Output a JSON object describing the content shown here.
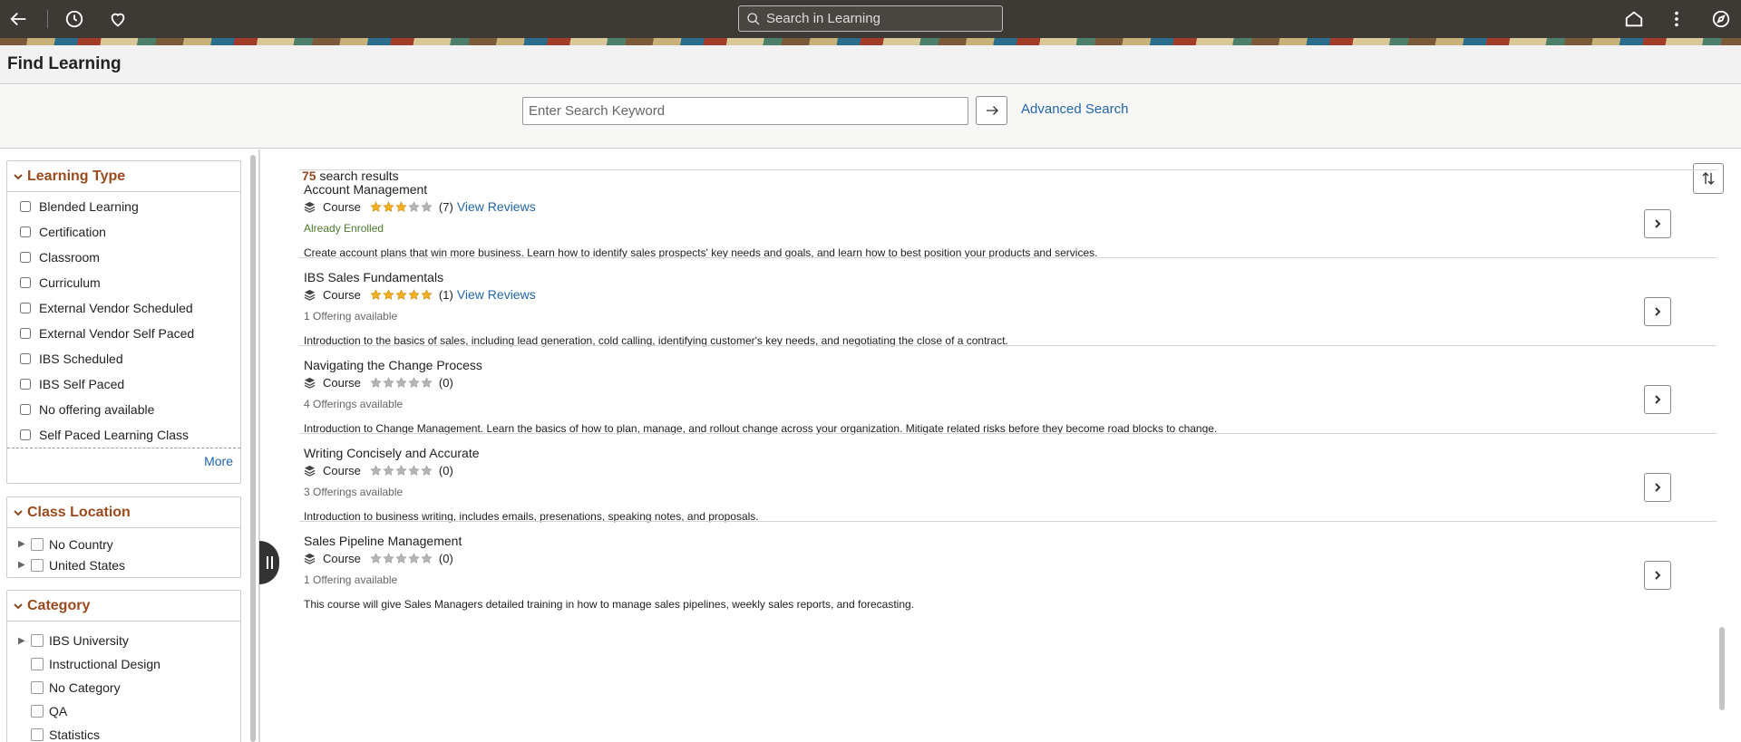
{
  "topbar": {
    "search_placeholder": "Search in Learning"
  },
  "page": {
    "title": "Find Learning"
  },
  "search": {
    "placeholder": "Enter Search Keyword",
    "advanced_label": "Advanced Search"
  },
  "facets": {
    "learning_type": {
      "title": "Learning Type",
      "items": [
        "Blended Learning",
        "Certification",
        "Classroom",
        "Curriculum",
        "External Vendor Scheduled",
        "External Vendor Self Paced",
        "IBS Scheduled",
        "IBS Self Paced",
        "No offering available",
        "Self Paced Learning Class"
      ],
      "more_label": "More"
    },
    "class_location": {
      "title": "Class Location",
      "items": [
        "No Country",
        "United States"
      ]
    },
    "category": {
      "title": "Category",
      "items": [
        "IBS University",
        "Instructional Design",
        "No Category",
        "QA",
        "Statistics"
      ]
    }
  },
  "results": {
    "count": "75",
    "count_suffix": " search results",
    "view_reviews_label": "View Reviews",
    "items": [
      {
        "title": "Account Management",
        "type": "Course",
        "rating": 3,
        "reviews": "(7)",
        "has_reviews_link": true,
        "status": "Already Enrolled",
        "description": "Create account plans that win more business. Learn how to identify sales prospects' key needs and goals, and learn how to best position your products and services."
      },
      {
        "title": "IBS Sales Fundamentals",
        "type": "Course",
        "rating": 5,
        "reviews": "(1)",
        "has_reviews_link": true,
        "status": "1 Offering available",
        "description": "Introduction to the basics of sales, including lead generation, cold calling, identifying customer's key needs, and negotiating the close of a contract."
      },
      {
        "title": "Navigating the Change Process",
        "type": "Course",
        "rating": 0,
        "reviews": "(0)",
        "has_reviews_link": false,
        "status": "4 Offerings available",
        "description": "Introduction to Change Management. Learn the basics of how to plan, manage, and rollout change across your organization. Mitigate related risks before they become road blocks to change."
      },
      {
        "title": "Writing Concisely and Accurate",
        "type": "Course",
        "rating": 0,
        "reviews": "(0)",
        "has_reviews_link": false,
        "status": "3 Offerings available",
        "description": "Introduction to business writing, includes emails, presenations, speaking notes, and proposals."
      },
      {
        "title": "Sales Pipeline Management",
        "type": "Course",
        "rating": 0,
        "reviews": "(0)",
        "has_reviews_link": false,
        "status": "1 Offering available",
        "description": "This course will give Sales Managers detailed training in how to manage sales pipelines, weekly sales reports, and forecasting."
      }
    ]
  },
  "colors": {
    "accent": "#9b4a1e",
    "link": "#2266aa",
    "star": "#f2b01e",
    "enrolled": "#4d7a2a"
  }
}
